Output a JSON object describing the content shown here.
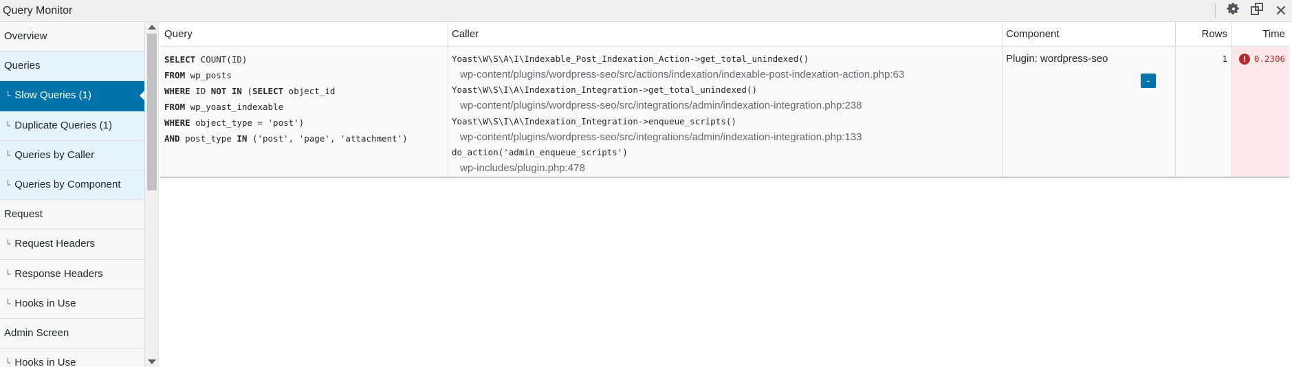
{
  "window": {
    "title": "Query Monitor"
  },
  "sidebar": {
    "items": [
      {
        "label": "Overview",
        "sub": false,
        "state": "normal"
      },
      {
        "label": "Queries",
        "sub": false,
        "state": "light"
      },
      {
        "label": "Slow Queries (1)",
        "sub": true,
        "state": "active"
      },
      {
        "label": "Duplicate Queries (1)",
        "sub": true,
        "state": "light"
      },
      {
        "label": "Queries by Caller",
        "sub": true,
        "state": "light"
      },
      {
        "label": "Queries by Component",
        "sub": true,
        "state": "light"
      },
      {
        "label": "Request",
        "sub": false,
        "state": "normal"
      },
      {
        "label": "Request Headers",
        "sub": true,
        "state": "normal"
      },
      {
        "label": "Response Headers",
        "sub": true,
        "state": "normal"
      },
      {
        "label": "Hooks in Use",
        "sub": true,
        "state": "normal"
      },
      {
        "label": "Admin Screen",
        "sub": false,
        "state": "normal"
      },
      {
        "label": "Hooks in Use",
        "sub": true,
        "state": "normal"
      }
    ],
    "sub_prefix": "└"
  },
  "table": {
    "headers": {
      "query": "Query",
      "caller": "Caller",
      "component": "Component",
      "rows": "Rows",
      "time": "Time"
    },
    "row": {
      "query_lines": [
        "SELECT COUNT(ID)",
        "FROM wp_posts",
        "WHERE ID NOT IN (SELECT object_id",
        "FROM wp_yoast_indexable",
        "WHERE object_type = 'post')",
        "AND post_type IN ('post', 'page', 'attachment')"
      ],
      "caller": [
        {
          "fn": "Yoast\\W\\S\\A\\I\\Indexable_Post_Indexation_Action->get_total_unindexed()",
          "file": "wp-content/plugins/wordpress-seo/src/actions/indexation/indexable-post-indexation-action.php:63"
        },
        {
          "fn": "Yoast\\W\\S\\I\\A\\Indexation_Integration->get_total_unindexed()",
          "file": "wp-content/plugins/wordpress-seo/src/integrations/admin/indexation-integration.php:238"
        },
        {
          "fn": "Yoast\\W\\S\\I\\A\\Indexation_Integration->enqueue_scripts()",
          "file": "wp-content/plugins/wordpress-seo/src/integrations/admin/indexation-integration.php:133"
        },
        {
          "fn": "do_action('admin_enqueue_scripts')",
          "file": "wp-includes/plugin.php:478"
        }
      ],
      "toggle_label": "-",
      "component": "Plugin: wordpress-seo",
      "rows": "1",
      "time": "0.2306",
      "error_icon": "!"
    }
  },
  "colors": {
    "accent": "#0073aa",
    "error": "#b32d2e",
    "time_bg": "#fce8e8",
    "light_nav": "#e5f3fd"
  }
}
